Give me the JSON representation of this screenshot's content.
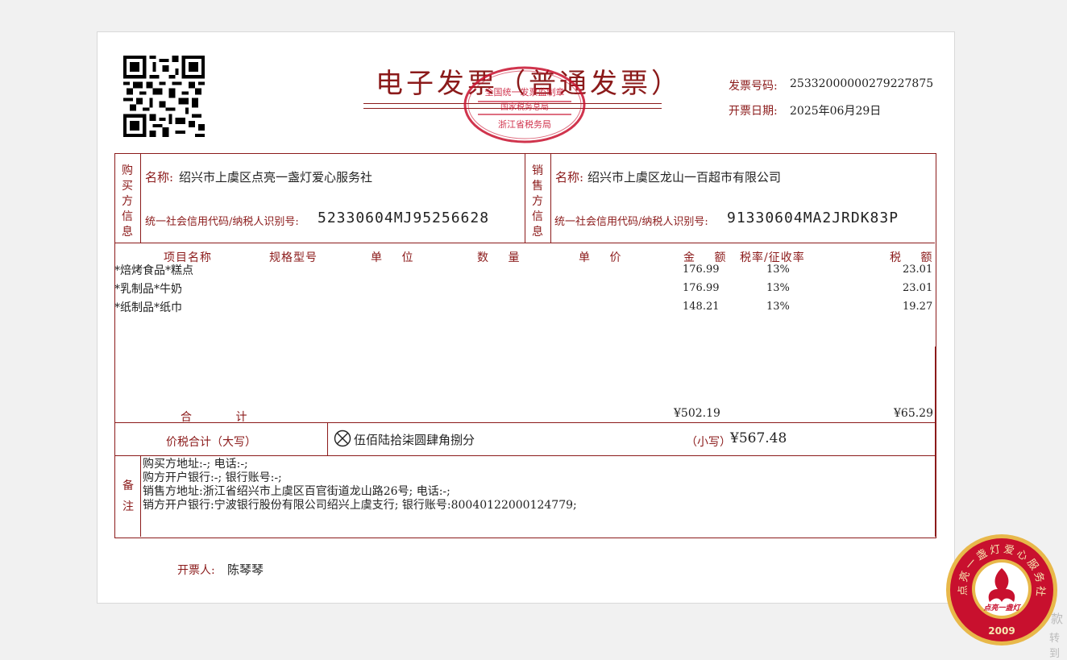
{
  "invoice": {
    "title": "电子发票（普通发票）",
    "number_label": "发票号码:",
    "number": "25332000000279227875",
    "date_label": "开票日期:",
    "date": "2025年06月29日",
    "tax_seal_lines": [
      "全国统一发票监制章",
      "国家税务总局",
      "浙江省税务局"
    ]
  },
  "buyer": {
    "section_label": "购买方信息",
    "name_label": "名称:",
    "name": "绍兴市上虞区点亮一盏灯爱心服务社",
    "taxid_label": "统一社会信用代码/纳税人识别号:",
    "taxid": "52330604MJ95256628"
  },
  "seller": {
    "section_label": "销售方信息",
    "name_label": "名称:",
    "name": "绍兴市上虞区龙山一百超市有限公司",
    "taxid_label": "统一社会信用代码/纳税人识别号:",
    "taxid": "91330604MA2JRDK83P"
  },
  "columns": {
    "item": "项目名称",
    "spec": "规格型号",
    "unit": "单 位",
    "qty": "数 量",
    "price": "单 价",
    "amount": "金 额",
    "rate": "税率/征收率",
    "tax": "税 额"
  },
  "items": [
    {
      "name": "*焙烤食品*糕点",
      "amount": "176.99",
      "rate": "13%",
      "tax": "23.01"
    },
    {
      "name": "*乳制品*牛奶",
      "amount": "176.99",
      "rate": "13%",
      "tax": "23.01"
    },
    {
      "name": "*纸制品*纸巾",
      "amount": "148.21",
      "rate": "13%",
      "tax": "19.27"
    }
  ],
  "totals": {
    "label": "合 计",
    "amount": "¥502.19",
    "tax": "¥65.29",
    "caps_label": "价税合计（大写）",
    "caps_value": "伍佰陆拾柒圆肆角捌分",
    "small_label": "（小写）",
    "small_value": "¥567.48"
  },
  "remarks": {
    "section_label": "备注",
    "lines": [
      "购买方地址:-;     电话:-;",
      "购方开户银行:-;     银行账号:-;",
      "销售方地址:浙江省绍兴市上虞区百官街道龙山路26号;     电话:-;",
      "销方开户银行:宁波银行股份有限公司绍兴上虞支行;     银行账号:80040122000124779;"
    ]
  },
  "issuer": {
    "label": "开票人:",
    "name": "陈琴琴"
  },
  "org_seal": {
    "ring_text": "点亮一盏灯爱心服务社",
    "center_text": "点亮一盏灯",
    "year": "2009"
  },
  "side_fragments": [
    "款",
    "转到"
  ],
  "colors": {
    "invoice_red": "#8b1a1a",
    "seal_red": "#c8102e",
    "seal_gold": "#e8b84a"
  }
}
